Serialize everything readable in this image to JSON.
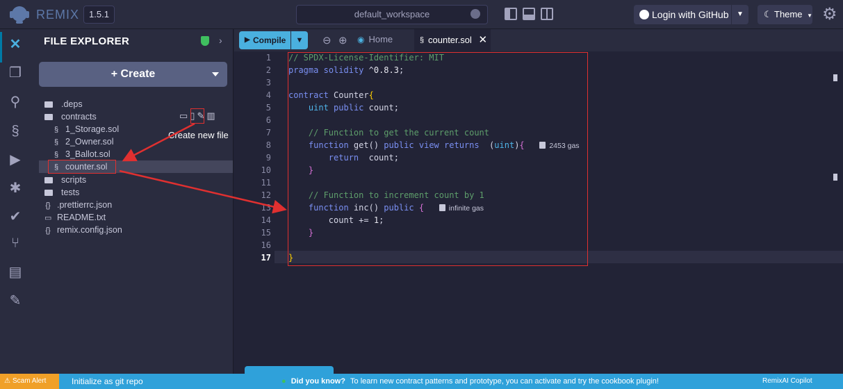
{
  "app": {
    "name": "REMIX",
    "version": "1.5.1",
    "workspace": "default_workspace"
  },
  "header": {
    "login_label": "Login with GitHub",
    "theme_label": "Theme"
  },
  "sidepanel": {
    "title": "FILE EXPLORER",
    "create_label": "+ Create",
    "tree": [
      {
        "label": ".deps",
        "type": "folder"
      },
      {
        "label": "contracts",
        "type": "folder"
      },
      {
        "label": "1_Storage.sol",
        "type": "sol"
      },
      {
        "label": "2_Owner.sol",
        "type": "sol"
      },
      {
        "label": "3_Ballot.sol",
        "type": "sol"
      },
      {
        "label": "counter.sol",
        "type": "sol",
        "selected": true
      },
      {
        "label": "scripts",
        "type": "folder"
      },
      {
        "label": "tests",
        "type": "folder"
      },
      {
        "label": ".prettierrc.json",
        "type": "json"
      },
      {
        "label": "README.txt",
        "type": "txt"
      },
      {
        "label": "remix.config.json",
        "type": "json"
      }
    ],
    "tooltip": "Create new file"
  },
  "editor": {
    "compile_label": "Compile",
    "home_tab": "Home",
    "active_tab": "counter.sol",
    "line_numbers": [
      "1",
      "2",
      "3",
      "4",
      "5",
      "6",
      "7",
      "8",
      "9",
      "10",
      "11",
      "12",
      "13",
      "14",
      "15",
      "16",
      "17"
    ],
    "current_line": "17",
    "gas_get": "2453 gas",
    "gas_inc": "infinite gas"
  },
  "bottom": {
    "scam_alert": "Scam Alert",
    "git_init": "Initialize as git repo",
    "did_you_know": "Did you know?",
    "tip": "To learn new contract patterns and prototype, you can activate and try the cookbook plugin!",
    "copilot": "RemixAI Copilot (enabled)"
  },
  "colors": {
    "accent": "#2fa1da",
    "annotation": "#e03030",
    "background": "#222336"
  }
}
